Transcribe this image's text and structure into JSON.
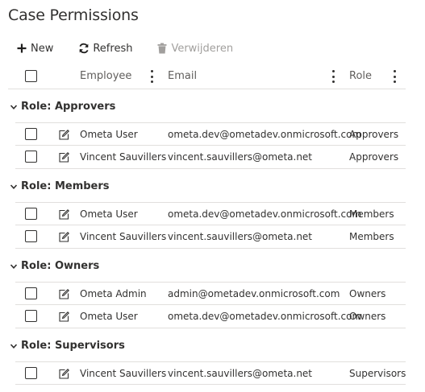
{
  "page": {
    "title": "Case Permissions"
  },
  "toolbar": {
    "new_label": "New",
    "new_icon": "plus-icon",
    "refresh_label": "Refresh",
    "refresh_icon": "refresh-icon",
    "delete_label": "Verwijderen",
    "delete_icon": "trash-icon"
  },
  "columns": {
    "employee": "Employee",
    "email": "Email",
    "role": "Role"
  },
  "groups": [
    {
      "label": "Role: Approvers",
      "rows": [
        {
          "employee": "Ometa User",
          "email": "ometa.dev@ometadev.onmicrosoft.com",
          "role": "Approvers"
        },
        {
          "employee": "Vincent Sauvillers",
          "email": "vincent.sauvillers@ometa.net",
          "role": "Approvers"
        }
      ]
    },
    {
      "label": "Role: Members",
      "rows": [
        {
          "employee": "Ometa User",
          "email": "ometa.dev@ometadev.onmicrosoft.com",
          "role": "Members"
        },
        {
          "employee": "Vincent Sauvillers",
          "email": "vincent.sauvillers@ometa.net",
          "role": "Members"
        }
      ]
    },
    {
      "label": "Role: Owners",
      "rows": [
        {
          "employee": "Ometa Admin",
          "email": "admin@ometadev.onmicrosoft.com",
          "role": "Owners"
        },
        {
          "employee": "Ometa User",
          "email": "ometa.dev@ometadev.onmicrosoft.com",
          "role": "Owners"
        }
      ]
    },
    {
      "label": "Role: Supervisors",
      "rows": [
        {
          "employee": "Vincent Sauvillers",
          "email": "vincent.sauvillers@ometa.net",
          "role": "Supervisors"
        }
      ]
    }
  ]
}
